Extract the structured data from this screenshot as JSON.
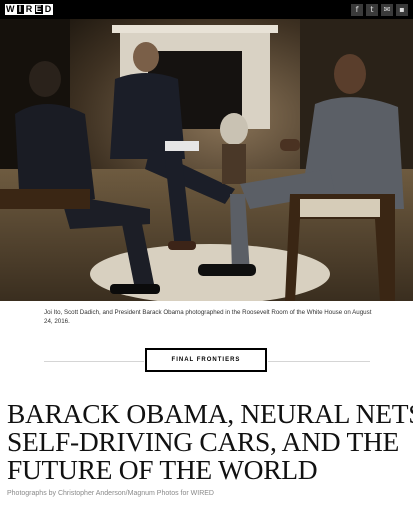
{
  "header": {
    "logo_letters": [
      "W",
      "I",
      "R",
      "E",
      "D"
    ],
    "social_icons": [
      {
        "name": "facebook-icon",
        "glyph": "f"
      },
      {
        "name": "twitter-icon",
        "glyph": "t"
      },
      {
        "name": "email-icon",
        "glyph": "✉"
      },
      {
        "name": "comment-icon",
        "glyph": "▪"
      }
    ]
  },
  "hero": {
    "caption": "Joi Ito, Scott Dadich, and President Barack Obama photographed in the Roosevelt Room of the White House on August 24, 2016."
  },
  "article": {
    "section_tag": "FINAL FRONTIERS",
    "headline_lines": [
      "BARACK OBAMA, NEURAL NETS,",
      "SELF-DRIVING CARS, AND THE",
      "FUTURE OF THE WORLD"
    ],
    "credit": "Photographs by Christopher Anderson/Magnum Photos for WIRED"
  },
  "colors": {
    "topbar": "#000000",
    "accent": "#000000",
    "rule": "#d5d5d5"
  }
}
